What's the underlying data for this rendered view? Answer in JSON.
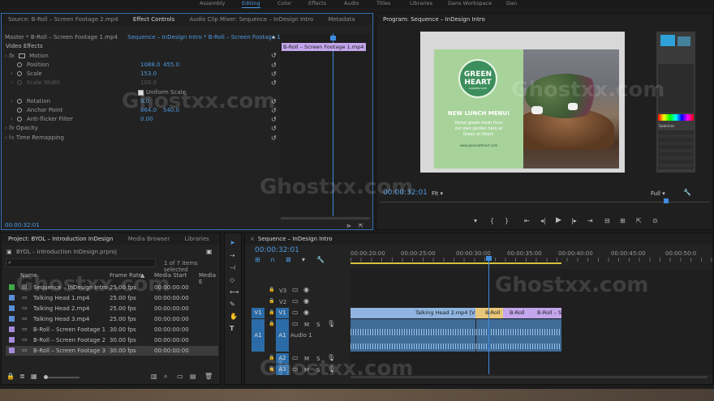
{
  "workspaces": [
    "Assembly",
    "Editing",
    "Color",
    "Effects",
    "Audio",
    "Titles",
    "Libraries",
    "Dans Workspace",
    "Dan"
  ],
  "active_workspace": "Editing",
  "source_panel": {
    "tabs": [
      "Source: B-Roll – Screen Footage 2.mp4",
      "Effect Controls",
      "Audio Clip Mixer: Sequence – InDesign Intro",
      "Metadata"
    ],
    "master_label": "Master * B-Roll – Screen Footage 1.mp4",
    "sequence_label": "Sequence – InDesign Intro * B-Roll – Screen Footage 1.mp4",
    "clip_label": "B-Roll – Screen Footage 1.mp4",
    "section": "Video Effects",
    "properties": {
      "motion": "Motion",
      "position": "Position",
      "position_x": "1088.0",
      "position_y": "455.0",
      "scale": "Scale",
      "scale_val": "153.0",
      "scale_width": "Scale Width",
      "scale_width_val": "100.0",
      "uniform_scale": "Uniform Scale",
      "rotation": "Rotation",
      "rotation_val": "0.0",
      "anchor": "Anchor Point",
      "anchor_x": "864.0",
      "anchor_y": "540.0",
      "antiflicker": "Anti-flicker Filter",
      "antiflicker_val": "0.00",
      "opacity": "Opacity",
      "time_remap": "Time Remapping"
    },
    "timecode": "00:00:32:01"
  },
  "program": {
    "title": "Program: Sequence – InDesign Intro",
    "timecode": "00:00:32:01",
    "fit": "Fit",
    "quality": "Full",
    "card": {
      "logo_top": "GREEN",
      "logo_bottom": "HEART",
      "logo_sub": "GARDEN CAFE",
      "headline": "NEW LUNCH MENU!",
      "body": "Home grown fresh from our own garden here at Green at Heart.",
      "url": "www.greenatheart.com"
    },
    "ps_swatches_label": "Swatches"
  },
  "project": {
    "tabs": [
      "Project: BYOL – Introduction InDesign",
      "Media Browser",
      "Libraries"
    ],
    "file": "BYOL – Introduction InDesign.prproj",
    "count": "1 of 7 items selected",
    "columns": [
      "Name",
      "Frame Rate",
      "Media Start",
      "Media E"
    ],
    "items": [
      {
        "name": "Sequence – InDesign Intro",
        "rate": "25.00 fps",
        "start": "00:00:00:00",
        "color": "#3faa4a"
      },
      {
        "name": "Talking Head 1.mp4",
        "rate": "25.00 fps",
        "start": "00:00:00:00",
        "color": "#5b8fd6"
      },
      {
        "name": "Talking Head 2.mp4",
        "rate": "25.00 fps",
        "start": "00:00:00:00",
        "color": "#5b8fd6"
      },
      {
        "name": "Talking Head 3.mp4",
        "rate": "25.00 fps",
        "start": "00:00:00:00",
        "color": "#5b8fd6"
      },
      {
        "name": "B-Roll – Screen Footage 1",
        "rate": "30.00 fps",
        "start": "00:00:00:00",
        "color": "#a58ad9"
      },
      {
        "name": "B-Roll – Screen Footage 2",
        "rate": "30.00 fps",
        "start": "00:00:00:00",
        "color": "#a58ad9"
      },
      {
        "name": "B-Roll – Screen Footage 3",
        "rate": "30.00 fps",
        "start": "00:00:00:00",
        "color": "#a58ad9"
      }
    ]
  },
  "timeline": {
    "title": "Sequence – InDesign Intro",
    "timecode": "00:00:32:01",
    "ruler": [
      "00:00:20:00",
      "00:00:25:00",
      "00:00:30:00",
      "00:00:35:00",
      "00:00:40:00",
      "00:00:45:00",
      "00:00:50:0"
    ],
    "tracks": {
      "v3": "V3",
      "v2": "V2",
      "v1": "V1",
      "a1": "A1",
      "a2": "A2",
      "a3": "A3",
      "v1_src": "V1",
      "a1_src": "A1"
    },
    "audio_label": "Audio 1",
    "clip_th": "Talking Head 2.mp4 [V]",
    "clip_broll1": "B-Roll",
    "clip_broll2": "B-Roll",
    "clip_broll3": "B-Roll – S",
    "m": "M",
    "s": "S"
  },
  "watermarks": [
    "Ghostxx.com",
    "Ghostxx.com",
    "Ghostxx.com",
    "Ghostxx.com",
    "Ghostxx.com",
    "Ghostxx.com"
  ],
  "colors": {
    "accent": "#2f6fb4",
    "timecode": "#4e9ae0",
    "playhead": "#3f8be0",
    "video_clip": "#8fb4e0",
    "broll_clip": "#c3a6ec",
    "audio_clip": "#3f6b97",
    "card_green": "#a7d39a"
  }
}
